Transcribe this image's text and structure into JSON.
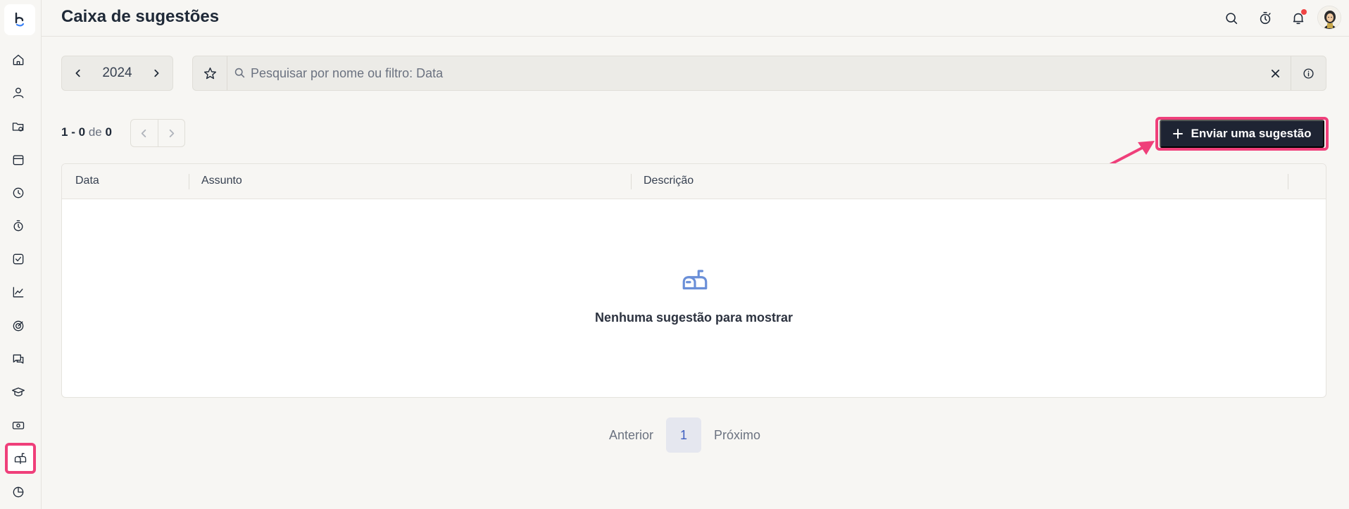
{
  "header": {
    "title": "Caixa de sugestões"
  },
  "filters": {
    "year": "2024",
    "search_placeholder": "Pesquisar por nome ou filtro: Data"
  },
  "pagination": {
    "range_start": "1",
    "range_sep": "-",
    "range_end": "0",
    "of_label": "de",
    "total": "0"
  },
  "actions": {
    "send_label": "Enviar uma sugestão"
  },
  "table": {
    "columns": [
      "Data",
      "Assunto",
      "Descrição"
    ],
    "empty_message": "Nenhuma sugestão para mostrar"
  },
  "bottom_pager": {
    "prev_label": "Anterior",
    "current_page": "1",
    "next_label": "Próximo"
  },
  "sidebar": {
    "items": [
      "home-icon",
      "user-icon",
      "folder-icon",
      "calendar-icon",
      "clock-icon",
      "timer-icon",
      "checkbox-icon",
      "chart-line-icon",
      "target-icon",
      "chat-icon",
      "graduation-cap-icon",
      "money-icon",
      "mailbox-icon",
      "pie-chart-icon"
    ],
    "active_item": "mailbox-icon"
  },
  "colors": {
    "accent_highlight": "#ef3f7a",
    "primary_button": "#1e2433",
    "empty_icon": "#6a8fd8",
    "notification_dot": "#ef4444"
  }
}
